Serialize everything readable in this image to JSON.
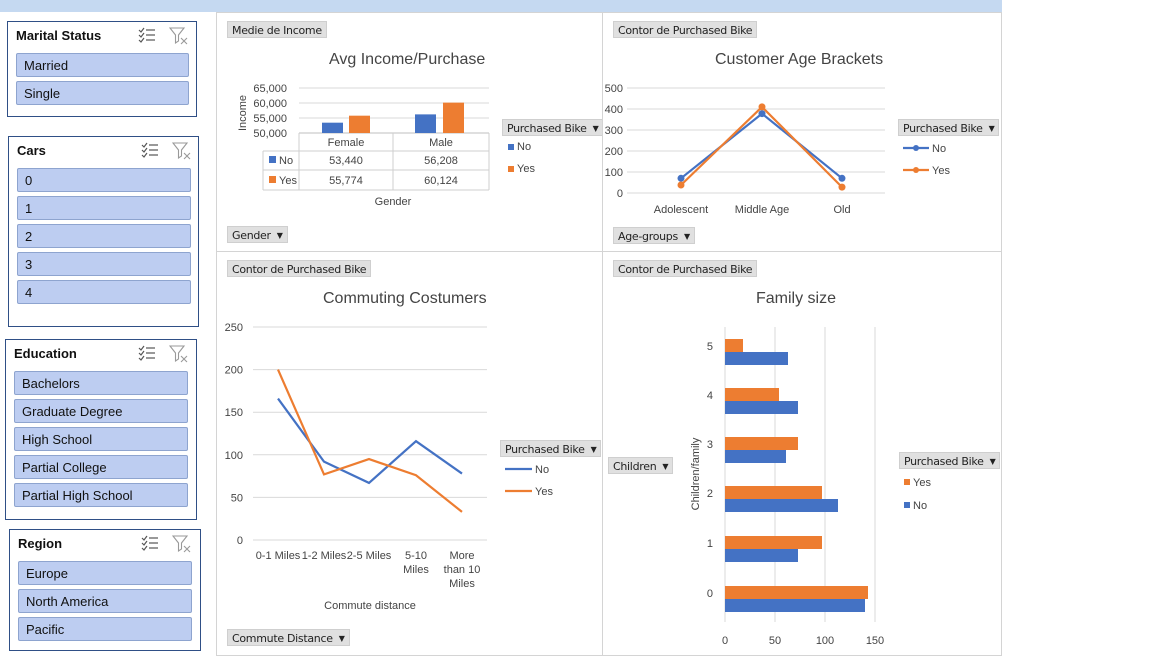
{
  "slicers": {
    "marital": {
      "title": "Marital Status",
      "items": [
        "Married",
        "Single"
      ]
    },
    "cars": {
      "title": "Cars",
      "items": [
        "0",
        "1",
        "2",
        "3",
        "4"
      ]
    },
    "education": {
      "title": "Education",
      "items": [
        "Bachelors",
        "Graduate Degree",
        "High School",
        "Partial College",
        "Partial High School"
      ]
    },
    "region": {
      "title": "Region",
      "items": [
        "Europe",
        "North America",
        "Pacific"
      ]
    }
  },
  "panels": {
    "income": {
      "value_field": "Medie de Income",
      "axis_button": "Gender",
      "legend_button": "Purchased Bike"
    },
    "age": {
      "value_field": "Contor de Purchased Bike",
      "axis_button": "Age-groups",
      "legend_button": "Purchased Bike"
    },
    "commute": {
      "value_field": "Contor de Purchased Bike",
      "axis_button": "Commute Distance",
      "legend_button": "Purchased Bike"
    },
    "family": {
      "value_field": "Contor de Purchased Bike",
      "axis_button": "Children",
      "legend_button": "Purchased Bike"
    }
  },
  "colors": {
    "no": "#4472c4",
    "yes": "#ed7d31",
    "slicer_item": "#bdcdf1",
    "slicer_border": "#2f4f86"
  },
  "chart_data": [
    {
      "type": "bar",
      "title": "Avg Income/Purchase",
      "xlabel": "Gender",
      "ylabel": "Income",
      "categories": [
        "Female",
        "Male"
      ],
      "series": [
        {
          "name": "No",
          "values": [
            53440,
            56208
          ],
          "labels": [
            "53,440",
            "56,208"
          ]
        },
        {
          "name": "Yes",
          "values": [
            55774,
            60124
          ],
          "labels": [
            "55,774",
            "60,124"
          ]
        }
      ],
      "ylim": [
        50000,
        65000
      ],
      "yticks": [
        "65,000",
        "60,000",
        "55,000",
        "50,000"
      ],
      "legend_position": "right",
      "data_table": true
    },
    {
      "type": "line",
      "title": "Customer Age Brackets",
      "categories": [
        "Adolescent",
        "Middle Age",
        "Old"
      ],
      "series": [
        {
          "name": "No",
          "values": [
            70,
            378,
            70
          ]
        },
        {
          "name": "Yes",
          "values": [
            38,
            410,
            28
          ]
        }
      ],
      "ylim": [
        0,
        500
      ],
      "yticks": [
        "500",
        "400",
        "300",
        "200",
        "100",
        "0"
      ],
      "legend_position": "right",
      "grid": true
    },
    {
      "type": "line",
      "title": "Commuting Costumers",
      "xlabel": "Commute distance",
      "categories": [
        [
          "0-1 Miles"
        ],
        [
          "1-2 Miles"
        ],
        [
          "2-5 Miles"
        ],
        [
          "5-10",
          "Miles"
        ],
        [
          "More",
          "than 10",
          "Miles"
        ]
      ],
      "series": [
        {
          "name": "No",
          "values": [
            166,
            92,
            67,
            116,
            78
          ]
        },
        {
          "name": "Yes",
          "values": [
            200,
            77,
            95,
            76,
            33
          ]
        }
      ],
      "ylim": [
        0,
        250
      ],
      "yticks": [
        "250",
        "200",
        "150",
        "100",
        "50",
        "0"
      ],
      "legend_position": "right",
      "grid": true
    },
    {
      "type": "bar",
      "orientation": "horizontal",
      "title": "Family size",
      "ylabel": "Children/family",
      "categories": [
        "5",
        "4",
        "3",
        "2",
        "1",
        "0"
      ],
      "series": [
        {
          "name": "Yes",
          "values": [
            18,
            54,
            73,
            97,
            97,
            143
          ]
        },
        {
          "name": "No",
          "values": [
            63,
            73,
            61,
            113,
            73,
            140
          ]
        }
      ],
      "xlim": [
        0,
        150
      ],
      "xticks": [
        "0",
        "50",
        "100",
        "150"
      ],
      "legend_position": "right",
      "grid": true
    }
  ]
}
